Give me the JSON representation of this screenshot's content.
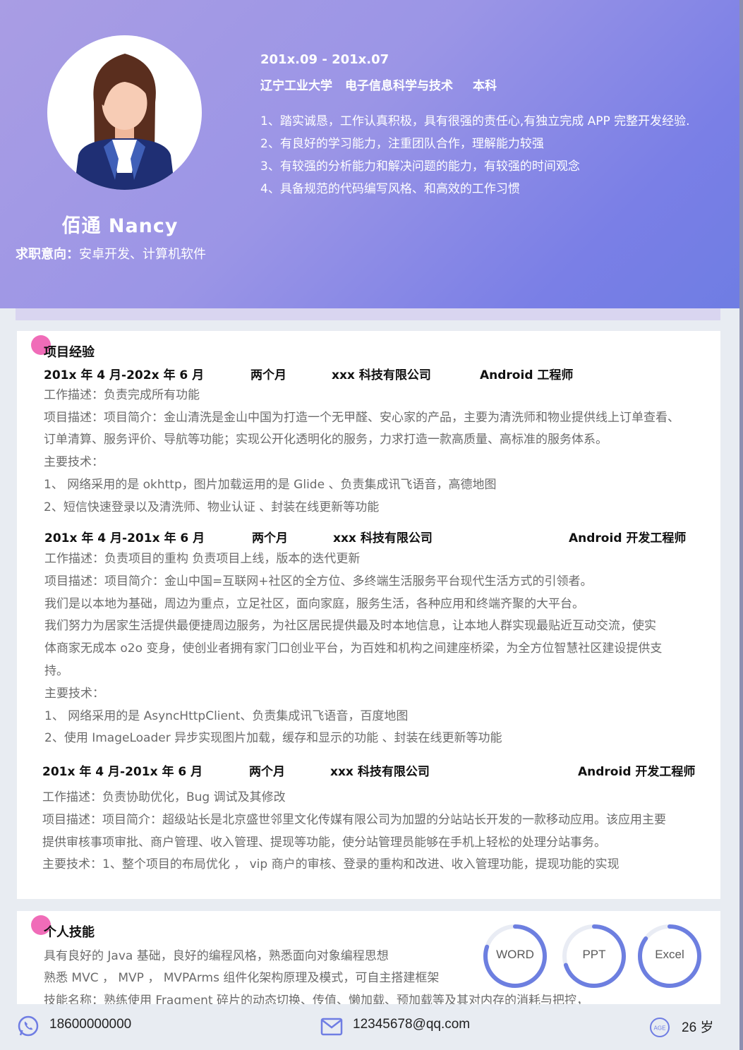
{
  "header": {
    "name": "佰通  Nancy",
    "intent_label": "求职意向：",
    "intent_value": "安卓开发、计算机软件",
    "edu_date": "201x.09 - 201x.07",
    "school": "辽宁工业大学",
    "major": "电子信息科学与技术",
    "degree": "本科",
    "traits": [
      "1、踏实诚恳，工作认真积极，具有很强的责任心,有独立完成 APP 完整开发经验.",
      "2、有良好的学习能力，注重团队合作，理解能力较强",
      "3、有较强的分析能力和解决问题的能力，有较强的时间观念",
      "4、具备规范的代码编写风格、和高效的工作习惯"
    ]
  },
  "projects": {
    "title": "项目经验",
    "items": [
      {
        "period": "201x 年 4 月-202x 年 6 月",
        "duration": "两个月",
        "company": "xxx 科技有限公司",
        "role": "Android 工程师",
        "lines": [
          "工作描述：负责完成所有功能",
          "项目描述：项目简介：金山清洗是金山中国为打造一个无甲醛、安心家的产品，主要为清洗师和物业提供线上订单查看、",
          "订单清算、服务评价、导航等功能；实现公开化透明化的服务，力求打造一款高质量、高标准的服务体系。",
          "主要技术：",
          "1、    网络采用的是 okhttp，图片加载运用的是 Glide 、负责集成讯飞语音，高德地图",
          "2、短信快速登录以及清洗师、物业认证 、封装在线更新等功能"
        ]
      },
      {
        "period": "201x 年 4 月-201x 年 6 月",
        "duration": "两个月",
        "company": "xxx 科技有限公司",
        "role": "Android 开发工程师",
        "lines": [
          "工作描述：负责项目的重构 负责项目上线，版本的迭代更新",
          "项目描述：项目简介：金山中国=互联网+社区的全方位、多终端生活服务平台现代生活方式的引领者。",
          "我们是以本地为基础，周边为重点，立足社区，面向家庭，服务生活，各种应用和终端齐聚的大平台。",
          "我们努力为居家生活提供最便捷周边服务，为社区居民提供最及时本地信息，让本地人群实现最贴近互动交流，使实",
          "体商家无成本 o2o 变身，使创业者拥有家门口创业平台，为百姓和机构之间建座桥梁，为全方位智慧社区建设提供支",
          "持。",
          "主要技术：",
          "1、    网络采用的是 AsyncHttpClient、负责集成讯飞语音，百度地图",
          "2、使用 ImageLoader 异步实现图片加载，缓存和显示的功能 、封装在线更新等功能"
        ]
      },
      {
        "period": "201x 年 4 月-201x 年 6 月",
        "duration": "两个月",
        "company": "xxx 科技有限公司",
        "role": "Android 开发工程师",
        "lines": [
          "工作描述：负责协助优化，Bug 调试及其修改",
          "项目描述：项目简介：超级站长是北京盛世邻里文化传媒有限公司为加盟的分站站长开发的一款移动应用。该应用主要",
          "提供审核事项审批、商户管理、收入管理、提现等功能，使分站管理员能够在手机上轻松的处理分站事务。",
          "主要技术：1、整个项目的布局优化 ， vip 商户的审核、登录的重构和改进、收入管理功能，提现功能的实现"
        ]
      }
    ]
  },
  "skills": {
    "title": "个人技能",
    "lines": [
      "具有良好的 Java 基础，良好的编程风格，熟悉面向对象编程思想",
      "熟悉 MVC ， MVP ， MVPArms 组件化架构原理及模式，可自主搭建框架",
      "技能名称：熟练使用 Fragment 碎片的动态切换、传值、懒加载、预加载等及其对内存的消耗与把控，"
    ],
    "gauges": [
      {
        "label": "WORD",
        "level": 0.8
      },
      {
        "label": "PPT",
        "level": 0.7
      },
      {
        "label": "Excel",
        "level": 0.85
      }
    ],
    "gauge_color": "#6d7fe0",
    "gauge_track": "#e9ecf4"
  },
  "footer": {
    "phone": "18600000000",
    "email": "12345678@qq.com",
    "age": "26 岁",
    "age_icon_text": "AGE",
    "icon_color": "#6f7de3"
  }
}
